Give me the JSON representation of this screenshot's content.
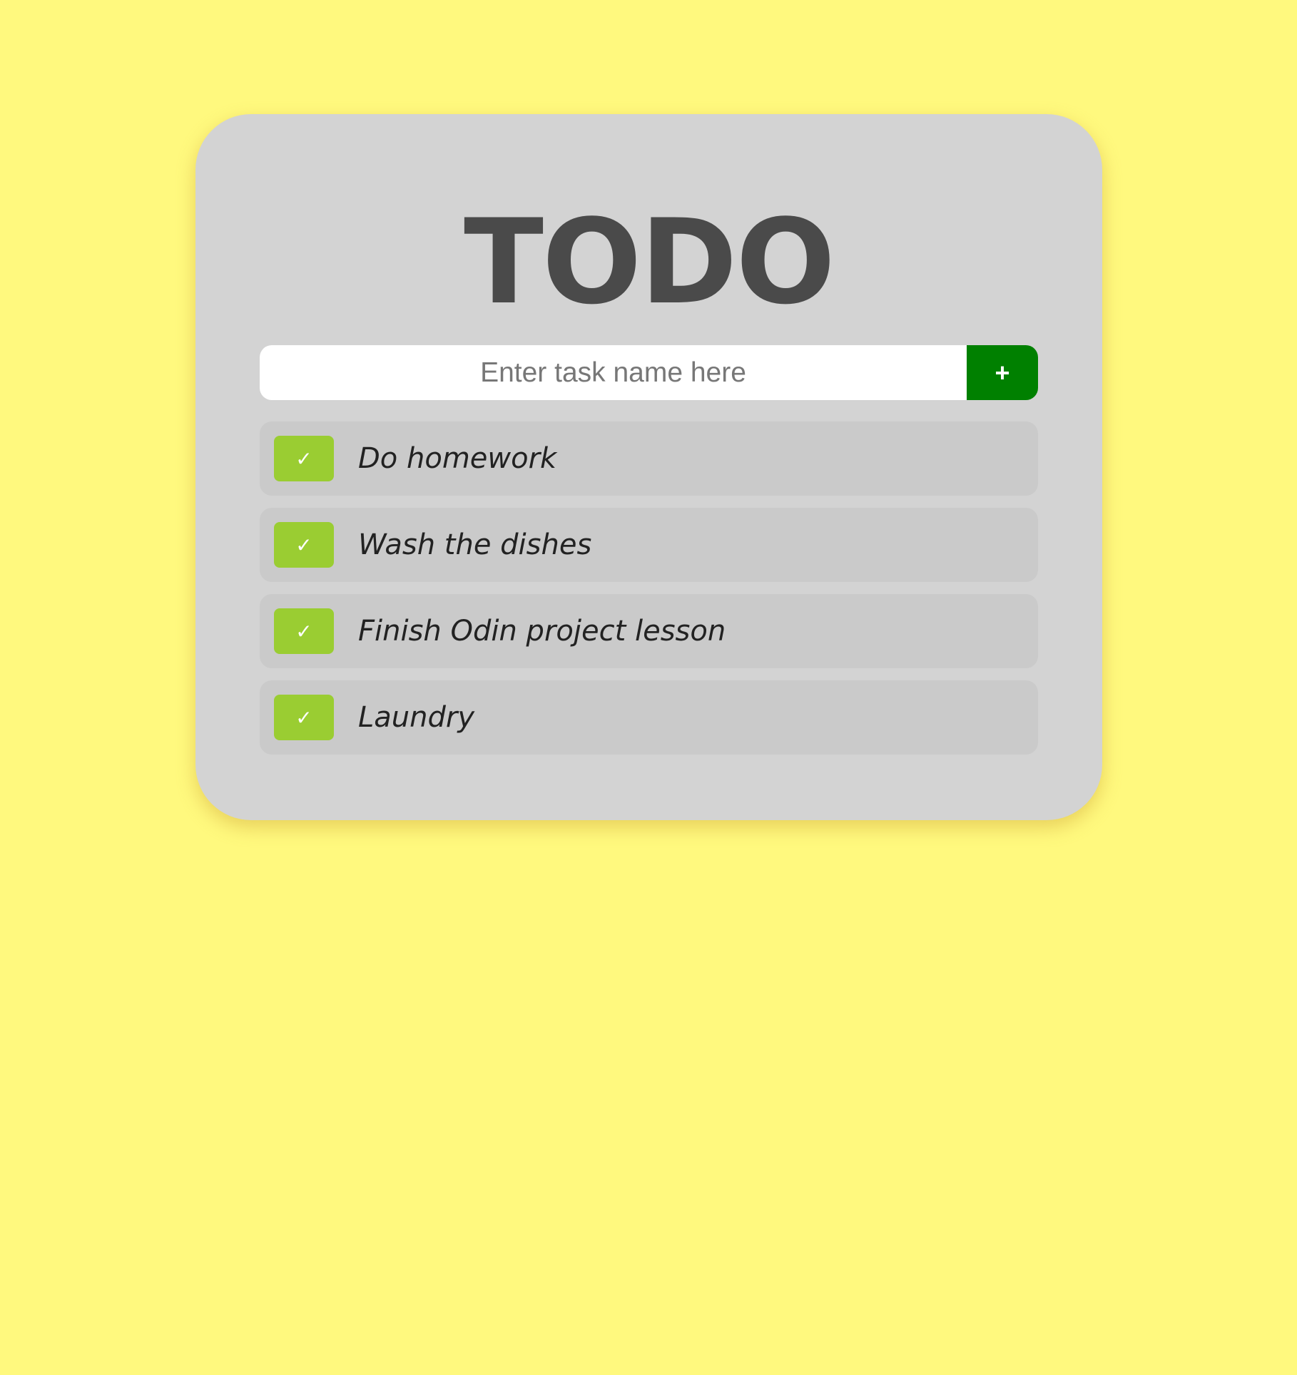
{
  "app": {
    "title": "TODO"
  },
  "new_task": {
    "placeholder": "Enter task name here",
    "value": "",
    "add_label": "+"
  },
  "tasks": [
    {
      "label": "Do homework",
      "check_label": "✓"
    },
    {
      "label": "Wash the dishes",
      "check_label": "✓"
    },
    {
      "label": "Finish Odin project lesson",
      "check_label": "✓"
    },
    {
      "label": "Laundry",
      "check_label": "✓"
    }
  ],
  "colors": {
    "background": "#fff97e",
    "card": "#d3d3d3",
    "task_row": "#cacaca",
    "add_button": "#008000",
    "check_button": "#9acd32",
    "title_text": "#4a4a4a"
  },
  "icons": {
    "add": "plus-icon",
    "complete": "checkmark-icon"
  }
}
